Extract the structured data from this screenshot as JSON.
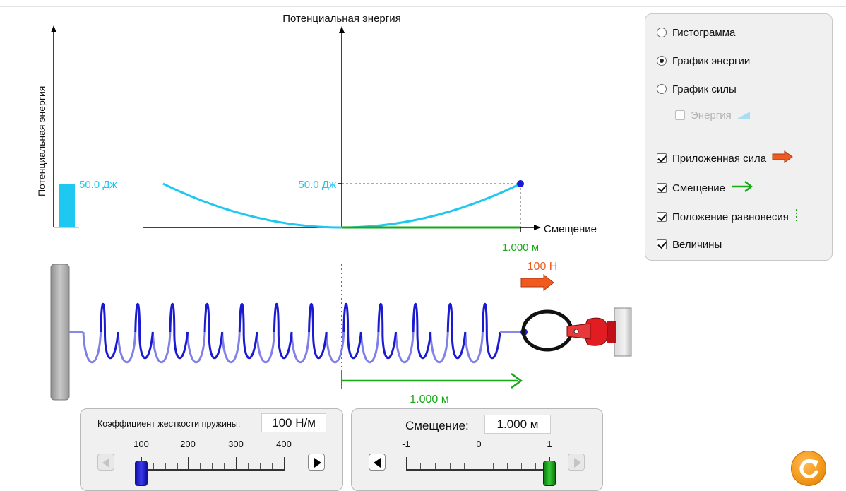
{
  "energy_graph": {
    "title": "Потенциальная энергия",
    "x_axis_label": "Смещение",
    "energy_value_label": "50.0 Дж",
    "displacement_value_label": "1.000 м"
  },
  "energy_bar": {
    "axis_label": "Потенциальная энергия",
    "value_label": "50.0 Дж",
    "value": 50.0
  },
  "scene": {
    "applied_force_label": "100 Н",
    "displacement_label": "1.000 м"
  },
  "controls": {
    "radio_options": [
      {
        "label": "Гистограмма",
        "selected": false
      },
      {
        "label": "График энергии",
        "selected": true
      },
      {
        "label": "График силы",
        "selected": false
      }
    ],
    "energy_checkbox": {
      "label": "Энергия",
      "checked": false,
      "enabled": false
    },
    "checkboxes": [
      {
        "label": "Приложенная сила",
        "checked": true,
        "icon": "orange-arrow-icon"
      },
      {
        "label": "Смещение",
        "checked": true,
        "icon": "green-arrow-icon"
      },
      {
        "label": "Положение равновесия",
        "checked": true,
        "icon": "green-dotted-line-icon"
      },
      {
        "label": "Величины",
        "checked": true,
        "icon": ""
      }
    ]
  },
  "spring_constant_slider": {
    "label": "Коэффициент жесткости пружины:",
    "value_text": "100 Н/м",
    "ticks": [
      "100",
      "200",
      "300",
      "400"
    ],
    "value": 100,
    "min": 100,
    "max": 400
  },
  "displacement_slider": {
    "label": "Смещение:",
    "value_text": "1.000 м",
    "ticks": [
      "-1",
      "0",
      "1"
    ],
    "value": 1.0,
    "min": -1,
    "max": 1
  },
  "colors": {
    "energy": "#1ec8f0",
    "displacement": "#18a818",
    "force": "#f05a1e",
    "spring": "#1a1ad2",
    "panel_bg": "#f0f0f0",
    "reset": "#f39a1a"
  }
}
